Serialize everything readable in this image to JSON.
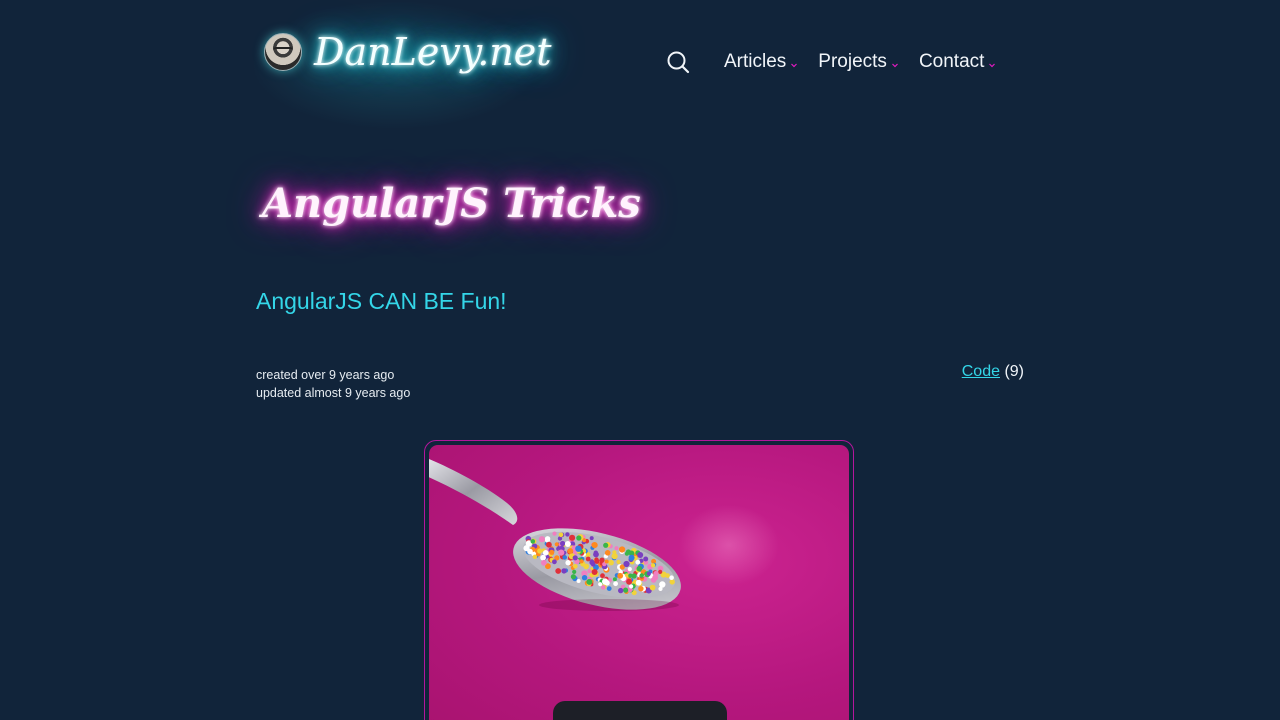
{
  "site": {
    "name": "DanLevy.net"
  },
  "nav": {
    "items": [
      {
        "label": "Articles"
      },
      {
        "label": "Projects"
      },
      {
        "label": "Contact"
      }
    ]
  },
  "post": {
    "title": "AngularJS Tricks",
    "subtitle": "AngularJS CAN BE Fun!",
    "created": "created over 9 years ago",
    "updated": "updated almost 9 years ago",
    "category": {
      "label": "Code",
      "count": "(9)"
    }
  },
  "icons": {
    "search": "search-icon",
    "chevron": "chevron-down-icon"
  },
  "colors": {
    "background": "#11243a",
    "accent_cyan": "#34d6e8",
    "accent_magenta": "#e21cc0",
    "hero_background": "#b5177e"
  }
}
